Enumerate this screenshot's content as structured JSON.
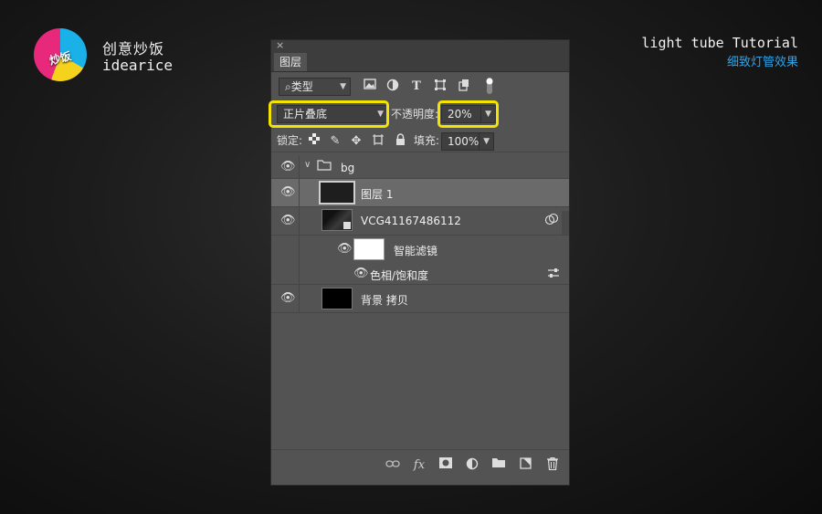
{
  "brand": {
    "logo_text": "炒饭",
    "name_cn": "创意炒饭",
    "name_en": "idearice"
  },
  "tutorial": {
    "title_en": "light tube Tutorial",
    "title_cn": "细致灯管效果"
  },
  "panel": {
    "close": "×",
    "tab": "图层",
    "filter": {
      "icon": "⌕",
      "value": "类型"
    },
    "blend_mode": "正片叠底",
    "opacity_label": "不透明度:",
    "opacity_value": "20%",
    "lock_label": "锁定:",
    "fill_label": "填充:",
    "fill_value": "100%",
    "layers": [
      {
        "name": "bg",
        "kind": "group"
      },
      {
        "name": "图层 1",
        "kind": "layer",
        "selected": true
      },
      {
        "name": "VCG41167486112",
        "kind": "smart-object"
      },
      {
        "name": "智能滤镜",
        "kind": "smart-filter"
      },
      {
        "name": "色相/饱和度",
        "kind": "filter-item"
      },
      {
        "name": "背景 拷贝",
        "kind": "layer"
      }
    ]
  },
  "colors": {
    "highlight": "#f2e400",
    "panel_bg": "#535353",
    "selected_row": "#6a6a6a",
    "accent_blue": "#2fa3e6"
  },
  "icons": [
    "eye-icon",
    "folder-icon",
    "link-icon",
    "fx-icon",
    "mask-icon",
    "adjustment-icon",
    "new-group-icon",
    "new-layer-icon",
    "trash-icon"
  ]
}
